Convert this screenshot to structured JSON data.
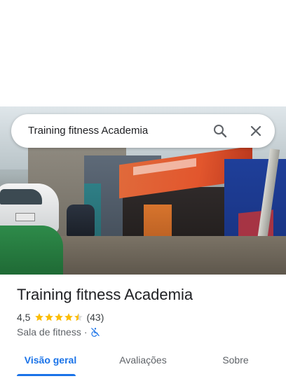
{
  "search": {
    "query": "Training fitness Academia"
  },
  "place": {
    "name": "Training fitness Academia",
    "rating": "4,5",
    "stars_value": 4.5,
    "stars_max": 5,
    "review_count": "(43)",
    "category": "Sala de fitness",
    "separator": "·",
    "accessibility_icon": "no-wheelchair-icon"
  },
  "tabs": [
    {
      "label": "Visão geral",
      "active": true
    },
    {
      "label": "Avaliações",
      "active": false
    },
    {
      "label": "Sobre",
      "active": false
    }
  ],
  "colors": {
    "accent": "#1a73e8",
    "star": "#fbbc04",
    "text_primary": "#202124",
    "text_secondary": "#5f6368"
  },
  "photo": {
    "subject": "storefront-street-photo"
  }
}
